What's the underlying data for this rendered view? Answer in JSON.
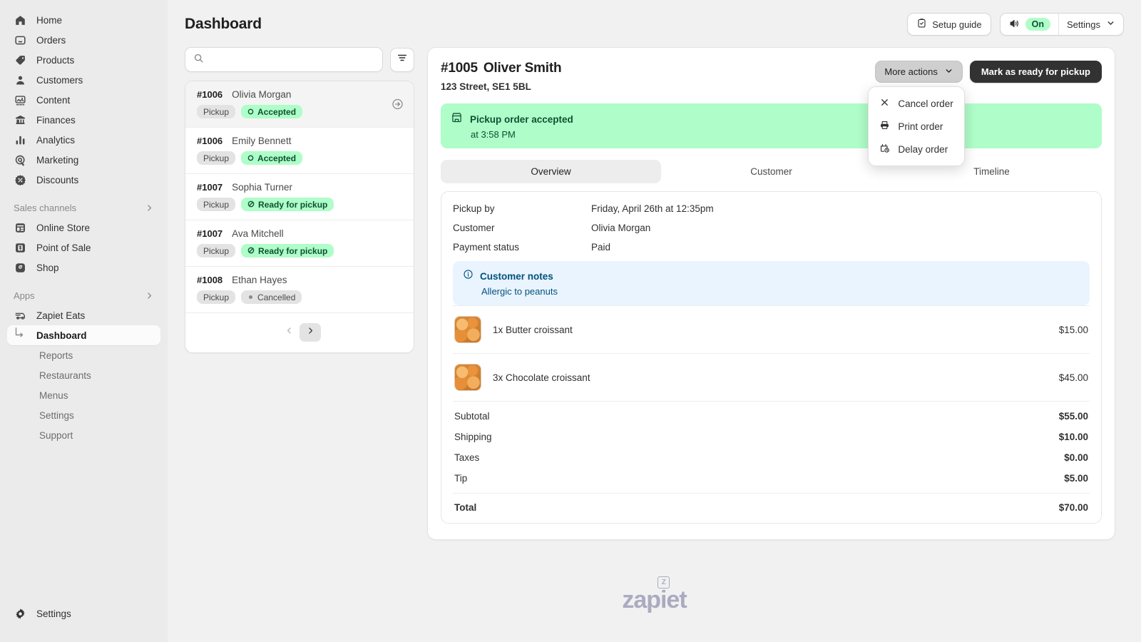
{
  "sidebar": {
    "primary": [
      {
        "label": "Home",
        "icon": "home-icon"
      },
      {
        "label": "Orders",
        "icon": "orders-icon"
      },
      {
        "label": "Products",
        "icon": "products-tag-icon"
      },
      {
        "label": "Customers",
        "icon": "customers-person-icon"
      },
      {
        "label": "Content",
        "icon": "content-image-icon"
      },
      {
        "label": "Finances",
        "icon": "finances-bank-icon"
      },
      {
        "label": "Analytics",
        "icon": "analytics-bars-icon"
      },
      {
        "label": "Marketing",
        "icon": "marketing-target-icon"
      },
      {
        "label": "Discounts",
        "icon": "discounts-badge-icon"
      }
    ],
    "sales_channels": {
      "label": "Sales channels",
      "chevron": "chevron-right-icon"
    },
    "channels": [
      {
        "label": "Online Store",
        "icon": "online-store-icon"
      },
      {
        "label": "Point of Sale",
        "icon": "point-of-sale-icon"
      },
      {
        "label": "Shop",
        "icon": "shop-icon"
      }
    ],
    "apps_label": "Apps",
    "apps_chevron": "chevron-right-icon",
    "app_name": "Zapiet Eats",
    "app_icon": "delivery-van-icon",
    "app_items": [
      {
        "label": "Dashboard",
        "active": true
      },
      {
        "label": "Reports",
        "active": false
      },
      {
        "label": "Restaurants",
        "active": false
      },
      {
        "label": "Menus",
        "active": false
      },
      {
        "label": "Settings",
        "active": false
      },
      {
        "label": "Support",
        "active": false
      }
    ],
    "bottom": {
      "label": "Settings",
      "icon": "gear-icon"
    }
  },
  "header": {
    "title": "Dashboard",
    "setup_guide": "Setup guide",
    "setup_guide_icon": "clipboard-check-icon",
    "sound_icon": "speaker-icon",
    "sound_state": "On",
    "settings_label": "Settings",
    "settings_chevron": "chevron-down-icon"
  },
  "orders_panel": {
    "search_placeholder": "",
    "search_value": "",
    "search_icon": "search-icon",
    "filter_icon": "filter-icon",
    "go_icon": "arrow-right-circle-icon",
    "rows": [
      {
        "number": "#1006",
        "name": "Olivia Morgan",
        "method": "Pickup",
        "status": "Accepted",
        "status_tone": "green",
        "status_icon": "circle-outline-icon",
        "selected": true
      },
      {
        "number": "#1006",
        "name": "Emily Bennett",
        "method": "Pickup",
        "status": "Accepted",
        "status_tone": "green",
        "status_icon": "circle-outline-icon",
        "selected": false
      },
      {
        "number": "#1007",
        "name": "Sophia Turner",
        "method": "Pickup",
        "status": "Ready for pickup",
        "status_tone": "green",
        "status_icon": "slash-circle-icon",
        "selected": false
      },
      {
        "number": "#1007",
        "name": "Ava Mitchell",
        "method": "Pickup",
        "status": "Ready for pickup",
        "status_tone": "green",
        "status_icon": "slash-circle-icon",
        "selected": false
      },
      {
        "number": "#1008",
        "name": "Ethan Hayes",
        "method": "Pickup",
        "status": "Cancelled",
        "status_tone": "grey",
        "status_icon": "dot-icon",
        "selected": false
      }
    ],
    "pager": {
      "prev_icon": "chevron-left-icon",
      "next_icon": "chevron-right-icon"
    }
  },
  "detail": {
    "order_number": "#1005",
    "customer_name": "Oliver Smith",
    "address": "123 Street, SE1 5BL",
    "more_actions_label": "More actions",
    "more_actions_chevron": "chevron-down-icon",
    "primary_action": "Mark as ready for pickup",
    "menu_items": [
      {
        "label": "Cancel order",
        "icon": "close-x-icon"
      },
      {
        "label": "Print order",
        "icon": "printer-icon"
      },
      {
        "label": "Delay order",
        "icon": "calendar-clock-icon"
      }
    ],
    "banner": {
      "icon": "storefront-icon",
      "title": "Pickup order accepted",
      "subtitle": "at 3:58 PM"
    },
    "tabs": [
      {
        "label": "Overview",
        "active": true
      },
      {
        "label": "Customer",
        "active": false
      },
      {
        "label": "Timeline",
        "active": false
      }
    ],
    "fields": [
      {
        "key": "Pickup by",
        "value": "Friday, April 26th at 12:35pm"
      },
      {
        "key": "Customer",
        "value": "Olivia Morgan"
      },
      {
        "key": "Payment status",
        "value": "Paid"
      }
    ],
    "notes": {
      "icon": "info-circle-icon",
      "title": "Customer notes",
      "body": "Allergic to peanuts"
    },
    "line_items": [
      {
        "name": "1x Butter croissant",
        "price": "$15.00",
        "thumb": "croissant-photo"
      },
      {
        "name": "3x Chocolate croissant",
        "price": "$45.00",
        "thumb": "croissant-photo"
      }
    ],
    "totals": [
      {
        "label": "Subtotal",
        "amount": "$55.00"
      },
      {
        "label": "Shipping",
        "amount": "$10.00"
      },
      {
        "label": "Taxes",
        "amount": "$0.00"
      },
      {
        "label": "Tip",
        "amount": "$5.00"
      }
    ],
    "grand_total": {
      "label": "Total",
      "amount": "$70.00"
    }
  },
  "footer": {
    "logo_text": "zapiet",
    "logo_badge": "Z"
  },
  "colors": {
    "accent_green_bg": "#affdc8",
    "accent_green_text": "#0c5132",
    "notes_bg": "#eaf4ff",
    "notes_text": "#00527c",
    "dark_button": "#333232",
    "sidebar_bg": "#ebebeb",
    "page_bg": "#f1f1f1"
  }
}
